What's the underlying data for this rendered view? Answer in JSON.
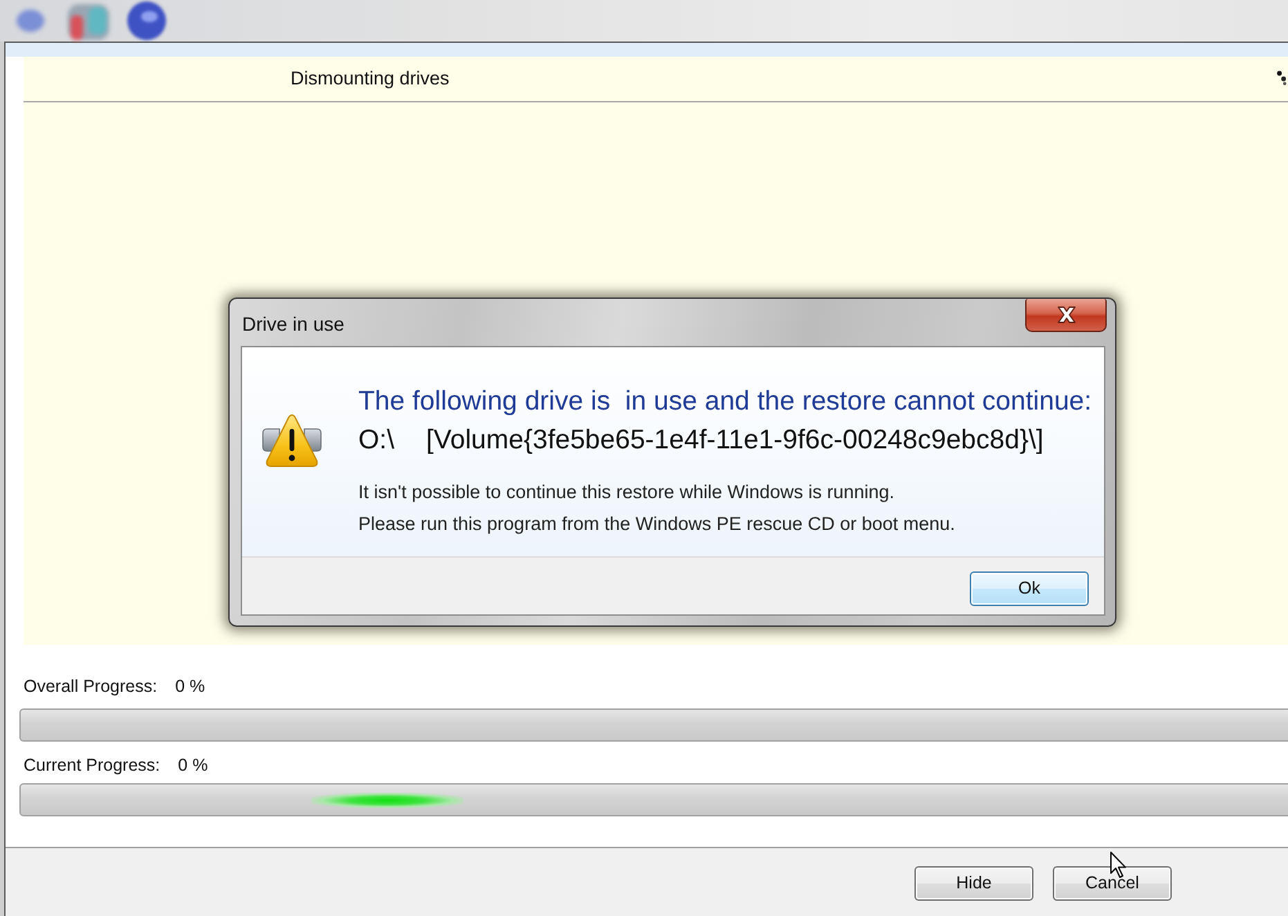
{
  "main_window": {
    "panel": {
      "title": "Dismounting drives"
    },
    "progress": [
      {
        "label": "Overall Progress:",
        "reading": "0 %",
        "marquee": false
      },
      {
        "label": "Current Progress:",
        "reading": "0 %",
        "marquee": true
      }
    ],
    "buttons": [
      {
        "label": "Hide",
        "focused": false
      },
      {
        "label": "Cancel",
        "focused": false
      }
    ]
  },
  "dialog": {
    "title": "Drive in use",
    "heading": "The following drive is  in use and the restore cannot continue:",
    "drive": {
      "letter": "O:\\",
      "volume": "[Volume{3fe5be65-1e4f-11e1-9f6c-00248c9ebc8d}\\]"
    },
    "message": [
      "It isn't possible to continue this restore while Windows is running.",
      "Please run this program from the Windows PE rescue CD or boot menu."
    ],
    "buttons": [
      {
        "label": "Ok",
        "focused": true
      }
    ]
  }
}
